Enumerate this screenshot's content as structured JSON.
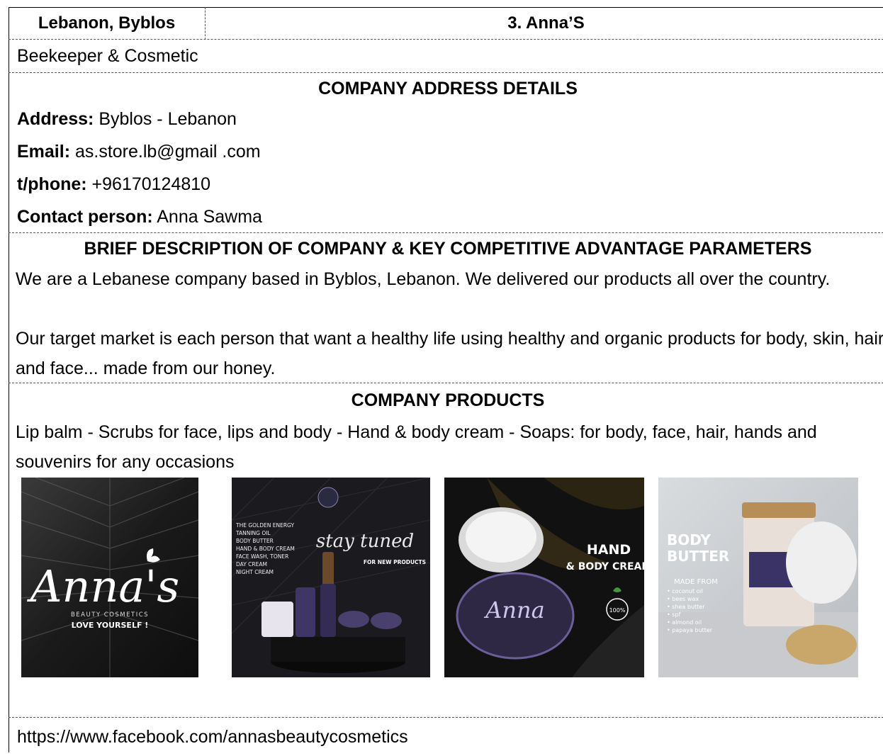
{
  "header": {
    "country": "Lebanon, Byblos",
    "company": "3.   Anna’S"
  },
  "category": "Beekeeper & Cosmetic",
  "address_section": {
    "title": "COMPANY ADDRESS DETAILS",
    "address_label": "Address:",
    "address_value": " Byblos - Lebanon",
    "email_label": "Email:",
    "email_value": " as.store.lb@gmail .com",
    "phone_label": "t/phone:",
    "phone_value": " +96170124810",
    "contact_label": "Contact person:",
    "contact_value": " Anna Sawma"
  },
  "description_section": {
    "title": "BRIEF DESCRIPTION OF COMPANY & KEY COMPETITIVE ADVANTAGE PARAMETERS",
    "p1": "We are a Lebanese company based in Byblos, Lebanon. We delivered our products all over the country.",
    "p2": "Our target market is each person that want a healthy life using healthy and organic products for body, skin, hair and face... made from our honey."
  },
  "products_section": {
    "title": "COMPANY PRODUCTS",
    "text": "Lip balm - Scrubs for face, lips and body - Hand & body cream - Soaps: for body, face, hair, hands and souvenirs for any occasions"
  },
  "images": {
    "img1": {
      "brand": "Anna's",
      "sub": "BEAUTY COSMETICS",
      "tag": "LOVE YOURSELF !"
    },
    "img2": {
      "list": [
        "THE GOLDEN ENERGY",
        "TANNING OIL",
        "BODY BUTTER",
        "HAND & BODY CREAM",
        "FACE WASH, TONER",
        "DAY CREAM",
        "NIGHT CREAM"
      ],
      "script": "stay tuned",
      "sub": "FOR NEW PRODUCTS"
    },
    "img3": {
      "line1": "HAND",
      "line2": "& BODY CREAM",
      "badge": "100%"
    },
    "img4": {
      "title1": "BODY",
      "title2": "BUTTER",
      "made": "MADE FROM",
      "items": [
        "• coconut oil",
        "• bees wax",
        "• shea butter",
        "• spf",
        "• almond oil",
        "• papaya butter"
      ]
    }
  },
  "footer": {
    "url": "https://www.facebook.com/annasbeautycosmetics"
  }
}
